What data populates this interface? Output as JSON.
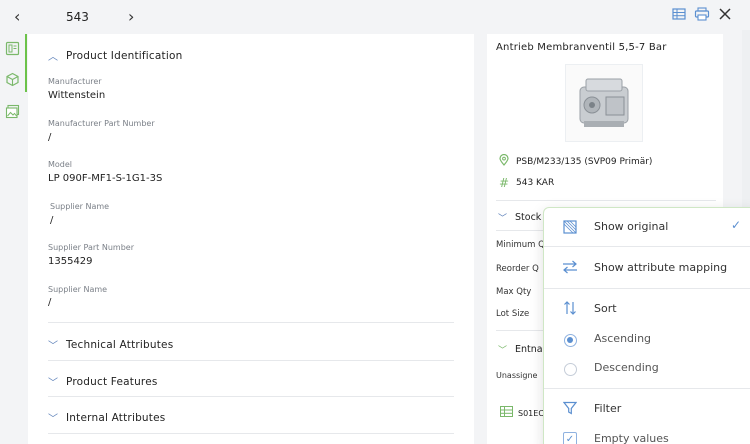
{
  "header": {
    "record_number": "543",
    "back_glyph": "‹",
    "forward_glyph": "›",
    "actions": [
      "table-view-icon",
      "print-icon",
      "close-icon"
    ]
  },
  "rail": {
    "items": [
      "document-icon",
      "cube-icon",
      "image-icon"
    ],
    "active_index": 0
  },
  "main": {
    "product_identification": {
      "title": "Product Identification",
      "fields": [
        {
          "label": "Manufacturer",
          "value": "Wittenstein"
        },
        {
          "label": "Manufacturer Part Number",
          "value": "/"
        },
        {
          "label": "Model",
          "value": "LP 090F-MF1-S-1G1-3S"
        },
        {
          "label": "Supplier Name",
          "value": "/"
        },
        {
          "label": "Supplier Part Number",
          "value": "1355429"
        },
        {
          "label": "Supplier Name",
          "value": "/"
        }
      ]
    },
    "collapsed_sections": [
      {
        "title": "Technical Attributes"
      },
      {
        "title": "Product Features"
      },
      {
        "title": "Internal Attributes"
      }
    ]
  },
  "side": {
    "product_title": "Antrieb Membranventil 5,5-7 Bar",
    "location": "PSB/M233/135 (SVP09 Primär)",
    "tag": "543 KAR",
    "stock_section": {
      "title": "Stock",
      "labels": [
        "Minimum Q",
        "Reorder Q",
        "Max Qty",
        "Lot Size"
      ]
    },
    "entnahme_section": {
      "title": "Entna",
      "labels": [
        "Unassigne"
      ]
    },
    "bottom_code": "S01EC"
  },
  "dropdown": {
    "items": [
      {
        "label": "Show original",
        "icon": "compare-icon",
        "checked": true
      },
      {
        "label": "Show attribute mapping",
        "icon": "swap-arrows-icon"
      },
      {
        "label": "Sort",
        "icon": "sort-icon"
      },
      {
        "label": "Ascending",
        "icon": "radio",
        "selected": true
      },
      {
        "label": "Descending",
        "icon": "radio",
        "selected": false
      },
      {
        "label": "Filter",
        "icon": "filter-icon"
      },
      {
        "label": "Empty values",
        "icon": "checkbox",
        "checked": true
      }
    ]
  },
  "colors": {
    "accent_green": "#6cc24a",
    "accent_blue": "#5b8fd0",
    "panel_bg": "#ffffff",
    "page_bg": "#f3f4f6"
  }
}
